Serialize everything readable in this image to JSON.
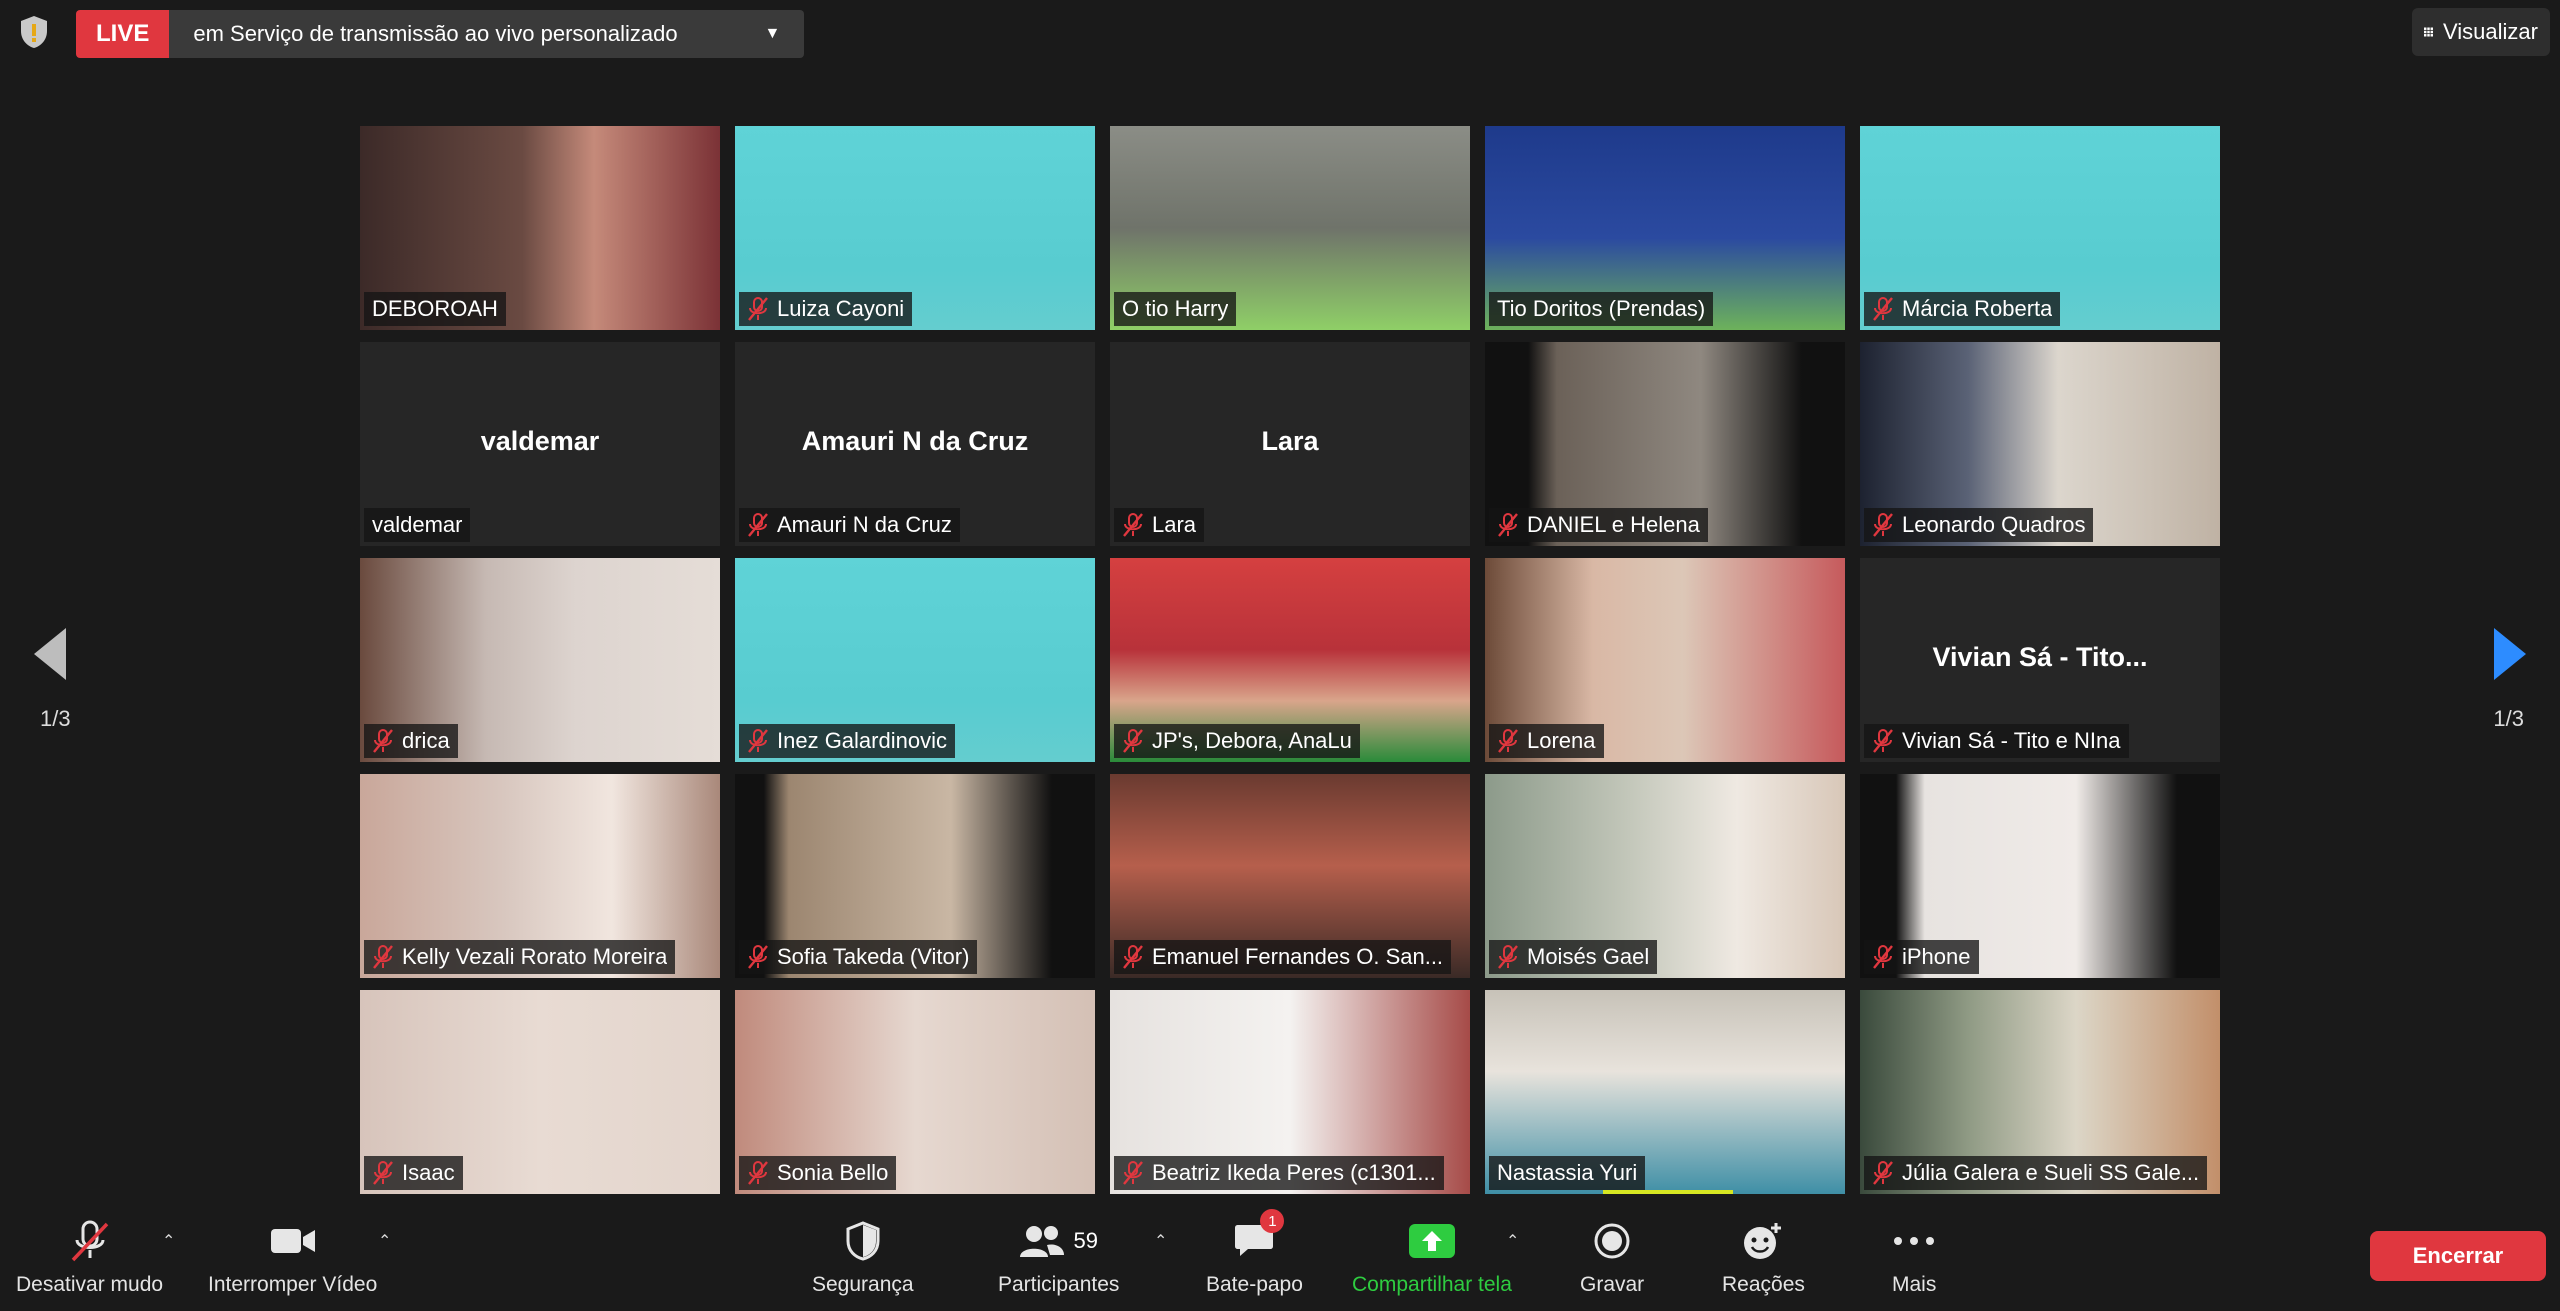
{
  "top_bar": {
    "live_label": "LIVE",
    "stream_label": "em Serviço de transmissão ao vivo personalizado",
    "view_label": "Visualizar"
  },
  "gallery": {
    "tiles": [
      {
        "name": "DEBOROAH",
        "muted": false
      },
      {
        "name": "Luiza Cayoni",
        "muted": true
      },
      {
        "name": "O tio Harry",
        "muted": false
      },
      {
        "name": "Tio Doritos (Prendas)",
        "muted": false
      },
      {
        "name": "Márcia Roberta",
        "muted": true
      },
      {
        "name": "valdemar",
        "muted": false,
        "center": "valdemar"
      },
      {
        "name": "Amauri N da Cruz",
        "muted": true,
        "center": "Amauri N da Cruz"
      },
      {
        "name": "Lara",
        "muted": true,
        "center": "Lara"
      },
      {
        "name": "DANIEL e Helena",
        "muted": true
      },
      {
        "name": "Leonardo Quadros",
        "muted": true
      },
      {
        "name": "drica",
        "muted": true
      },
      {
        "name": "Inez Galardinovic",
        "muted": true
      },
      {
        "name": "JP's, Debora, AnaLu",
        "muted": true
      },
      {
        "name": "Lorena",
        "muted": true
      },
      {
        "name": "Vivian Sá - Tito e NIna",
        "muted": true,
        "center": "Vivian Sá - Tito..."
      },
      {
        "name": "Kelly Vezali Rorato Moreira",
        "muted": true
      },
      {
        "name": "Sofia Takeda (Vitor)",
        "muted": true
      },
      {
        "name": "Emanuel Fernandes O. San...",
        "muted": true
      },
      {
        "name": "Moisés Gael",
        "muted": true
      },
      {
        "name": "iPhone",
        "muted": true
      },
      {
        "name": "Isaac",
        "muted": true
      },
      {
        "name": "Sonia Bello",
        "muted": true
      },
      {
        "name": "Beatriz Ikeda Peres (c1301...",
        "muted": true
      },
      {
        "name": "Nastassia Yuri",
        "muted": false
      },
      {
        "name": "Júlia Galera e Sueli SS Gale...",
        "muted": true
      }
    ]
  },
  "pager": {
    "left": "1/3",
    "right": "1/3"
  },
  "toolbar": {
    "mute": "Desativar mudo",
    "video": "Interromper Vídeo",
    "security": "Segurança",
    "participants": "Participantes",
    "participants_count": "59",
    "chat": "Bate-papo",
    "chat_badge": "1",
    "share": "Compartilhar tela",
    "record": "Gravar",
    "reactions": "Reações",
    "more": "Mais",
    "end": "Encerrar"
  },
  "colors": {
    "live": "#e0373f",
    "active_speaker": "#d6e622",
    "share_green": "#2ecc40",
    "next_arrow": "#2d8cff"
  }
}
